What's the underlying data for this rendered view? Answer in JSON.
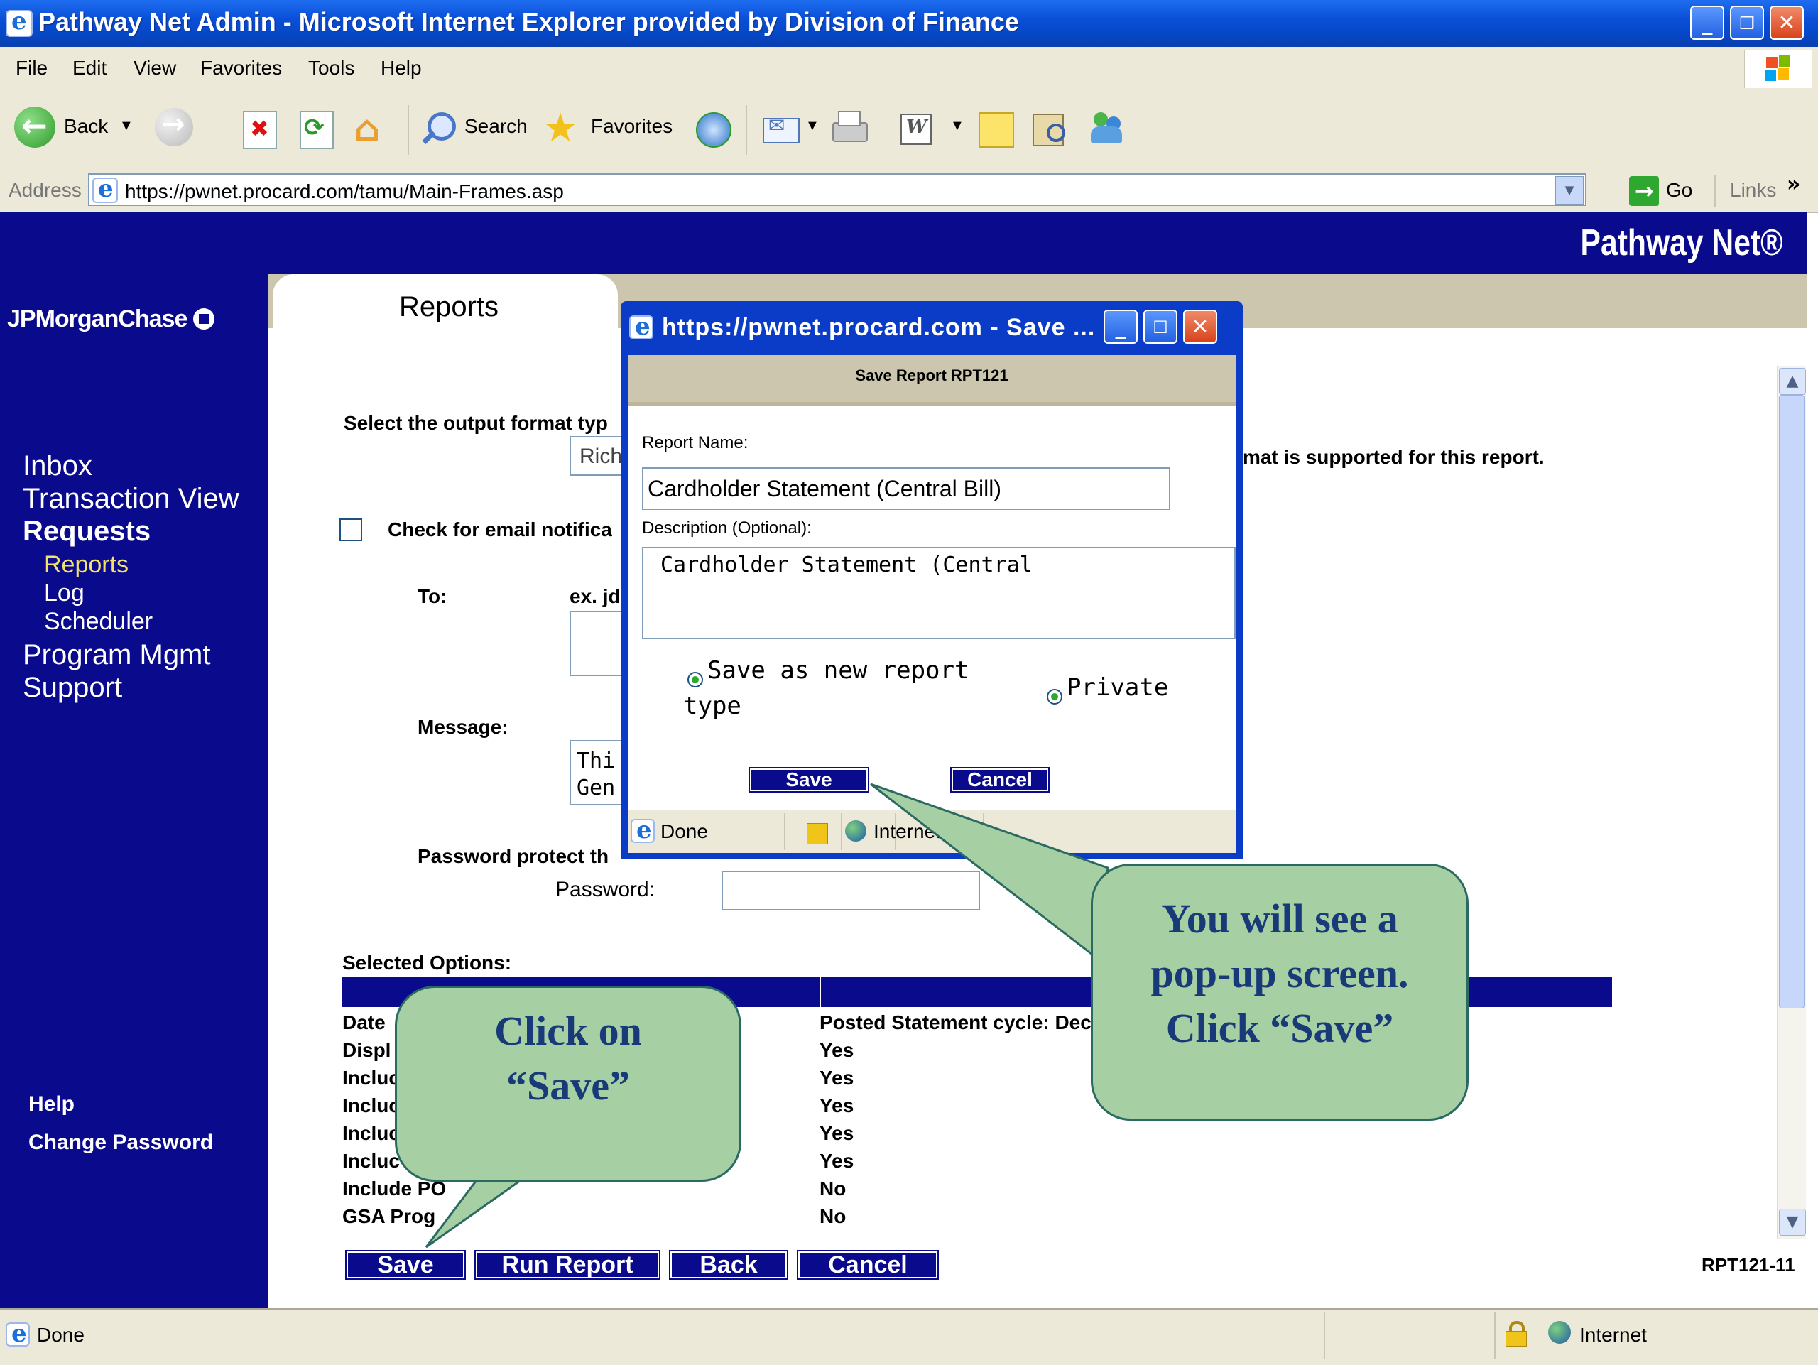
{
  "window": {
    "title": "Pathway Net Admin - Microsoft Internet Explorer provided by Division of Finance"
  },
  "menu": [
    "File",
    "Edit",
    "View",
    "Favorites",
    "Tools",
    "Help"
  ],
  "toolbar": {
    "back": "Back",
    "search": "Search",
    "favorites": "Favorites"
  },
  "address": {
    "label": "Address",
    "url": "https://pwnet.procard.com/tamu/Main-Frames.asp",
    "go": "Go",
    "links": "Links"
  },
  "header": {
    "brand": "Pathway Net®",
    "logo": "JPMorganChase"
  },
  "sidebar": {
    "inbox": "Inbox",
    "transaction_view": "Transaction View",
    "requests": "Requests",
    "reports": "Reports",
    "log": "Log",
    "scheduler": "Scheduler",
    "program_mgmt": "Program Mgmt",
    "support": "Support",
    "help": "Help",
    "change_password": "Change Password"
  },
  "main": {
    "tab": "Reports",
    "output_format_label": "Select the output format typ",
    "output_format_value": "Rich",
    "format_note": "mat is supported for this report.",
    "email_check_label": "Check for email notifica",
    "to_label": "To:",
    "to_hint": "ex. jd",
    "message_label": "Message:",
    "message_line1": "Thi",
    "message_line2": "Gen",
    "password_protect_label": "Password protect th",
    "password_label": "Password:",
    "selected_options_label": "Selected Options:",
    "options": [
      {
        "name": "Date",
        "value": "Posted Statement cycle: Dec"
      },
      {
        "name": "Displ",
        "value": "Yes"
      },
      {
        "name": "Incluc",
        "value": "Yes"
      },
      {
        "name": "Incluc",
        "value": "Yes"
      },
      {
        "name": "Incluc",
        "value": "Yes"
      },
      {
        "name": "Incluc",
        "value": "Yes"
      },
      {
        "name": "Include PO",
        "value": "No"
      },
      {
        "name": "GSA Prog",
        "value": "No"
      }
    ],
    "buttons": {
      "save": "Save",
      "run_report": "Run Report",
      "back": "Back",
      "cancel": "Cancel"
    },
    "report_id": "RPT121-11"
  },
  "popup": {
    "title": "https://pwnet.procard.com - Save ...",
    "header": "Save Report RPT121",
    "report_name_label": "Report Name:",
    "report_name_value": "Cardholder Statement (Central Bill)",
    "description_label": "Description (Optional):",
    "description_value": "Cardholder Statement (Central",
    "radio_new_line1": "Save as new report",
    "radio_new_line2": "type",
    "radio_private": "Private",
    "save": "Save",
    "cancel": "Cancel",
    "status_done": "Done",
    "status_zone": "Internet"
  },
  "callouts": {
    "left_line1": "Click on",
    "left_line2": "“Save”",
    "right_line1": "You will see a",
    "right_line2": "pop-up screen.",
    "right_line3": "Click “Save”"
  },
  "status": {
    "done": "Done",
    "zone": "Internet"
  },
  "colors": {
    "navy": "#0a0a8c",
    "xp_blue": "#0a4fd8",
    "tab_tan": "#ccc6ae",
    "callout_green": "#a6cfa3"
  }
}
